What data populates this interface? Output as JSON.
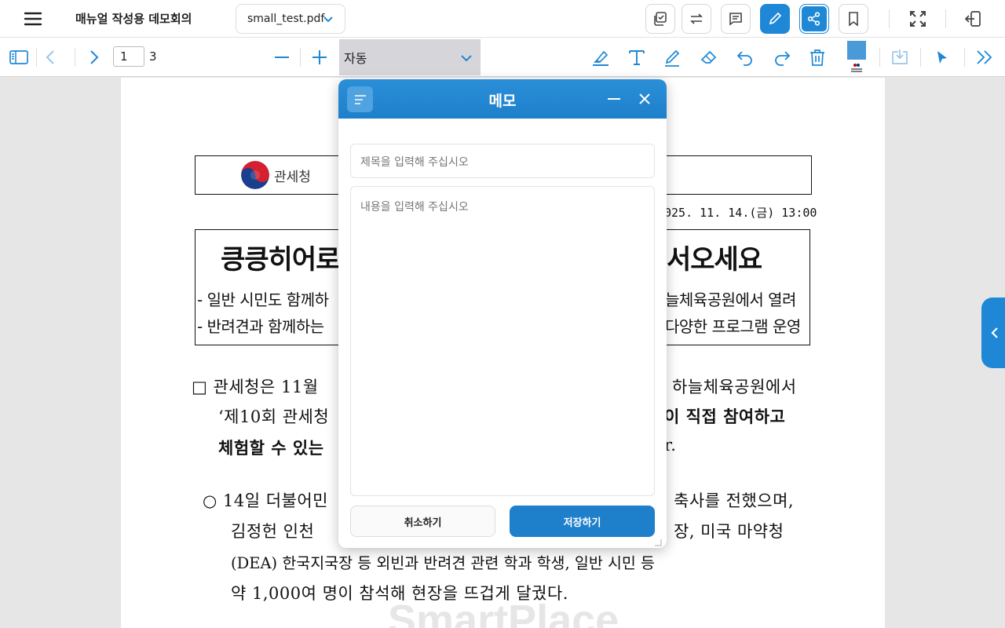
{
  "header": {
    "doc_title": "매뉴얼 작성용 데모회의",
    "file_name": "small_test.pdf"
  },
  "toolbar": {
    "page_current": "1",
    "page_total": "3",
    "zoom_value": "자동",
    "accent": "#1e88d6",
    "pen_color": "#4a9ad8"
  },
  "document": {
    "logo_text": "관세청",
    "datetime": "025. 11. 14.(금) 13:00",
    "title_left": "킁킁히어로",
    "title_right": "서오세요",
    "sub1_left": "-  일반 시민도 함께하",
    "sub1_right": "늘체육공원에서 열려",
    "sub2_left": "-  반려견과 함께하는",
    "sub2_right": "다양한 프로그램 운영",
    "p1_l1_left": "□  관세청은 11월",
    "p1_l1_right": "하늘체육공원에서",
    "p1_l2_left": "‘제10회 관세청",
    "p1_l2_right": "이 직접 참여하고",
    "p1_l3_left": "체험할 수 있는",
    "p1_l3_right": "r.",
    "p2_l1_left": "○  14일 더불어민",
    "p2_l1_right": "축사를 전했으며,",
    "p2_l2_left": "김정헌  인천",
    "p2_l2_right": "장,  미국  마약청",
    "p2_l3": "(DEA) 한국지국장 등 외빈과 반려견 관련 학과 학생, 일반 시민 등",
    "p2_l4": "약 1,000여 명이 참석해 현장을 뜨겁게 달궜다.",
    "watermark": "SmartPlace"
  },
  "memo": {
    "title": "메모",
    "title_placeholder": "제목을 입력해 주십시오",
    "body_placeholder": "내용을 입력해 주십시오",
    "cancel_label": "취소하기",
    "save_label": "저장하기"
  }
}
